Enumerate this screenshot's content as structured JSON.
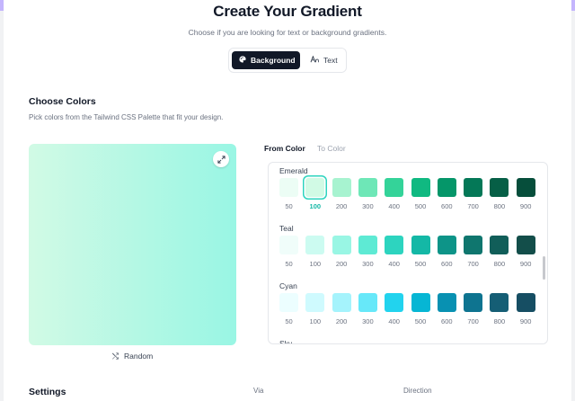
{
  "header": {
    "title": "Create Your Gradient",
    "subtitle": "Choose if you are looking for text or background gradients."
  },
  "mode_toggle": {
    "background_label": "Background",
    "text_label": "Text",
    "background_icon": "palette-icon",
    "text_icon": "font-icon",
    "selected": "Background"
  },
  "choose_colors": {
    "title": "Choose Colors",
    "description": "Pick colors from the Tailwind CSS Palette that fit your design."
  },
  "preview": {
    "from_color": "#d1fae5",
    "to_color": "#99f6e4",
    "expand_icon": "expand-icon"
  },
  "random": {
    "label": "Random",
    "icon": "shuffle-icon"
  },
  "color_tabs": {
    "from_label": "From Color",
    "to_label": "To Color",
    "selected": "From Color"
  },
  "palette": {
    "shades": [
      "50",
      "100",
      "200",
      "300",
      "400",
      "500",
      "600",
      "700",
      "800",
      "900"
    ],
    "selected": {
      "group": "Emerald",
      "shade": "100"
    },
    "groups": [
      {
        "name": "Emerald",
        "colors": [
          "#ecfdf5",
          "#d1fae5",
          "#a7f3d0",
          "#6ee7b7",
          "#34d399",
          "#10b981",
          "#059669",
          "#047857",
          "#065f46",
          "#064e3b"
        ]
      },
      {
        "name": "Teal",
        "colors": [
          "#f0fdfa",
          "#ccfbf1",
          "#99f6e4",
          "#5eead4",
          "#2dd4bf",
          "#14b8a6",
          "#0d9488",
          "#0f766e",
          "#115e59",
          "#134e4a"
        ]
      },
      {
        "name": "Cyan",
        "colors": [
          "#ecfeff",
          "#cffafe",
          "#a5f3fc",
          "#67e8f9",
          "#22d3ee",
          "#06b6d4",
          "#0891b2",
          "#0e7490",
          "#155e75",
          "#164e63"
        ]
      },
      {
        "name": "Sky",
        "colors": []
      }
    ]
  },
  "settings": {
    "title": "Settings",
    "via_label": "Via",
    "direction_label": "Direction"
  }
}
